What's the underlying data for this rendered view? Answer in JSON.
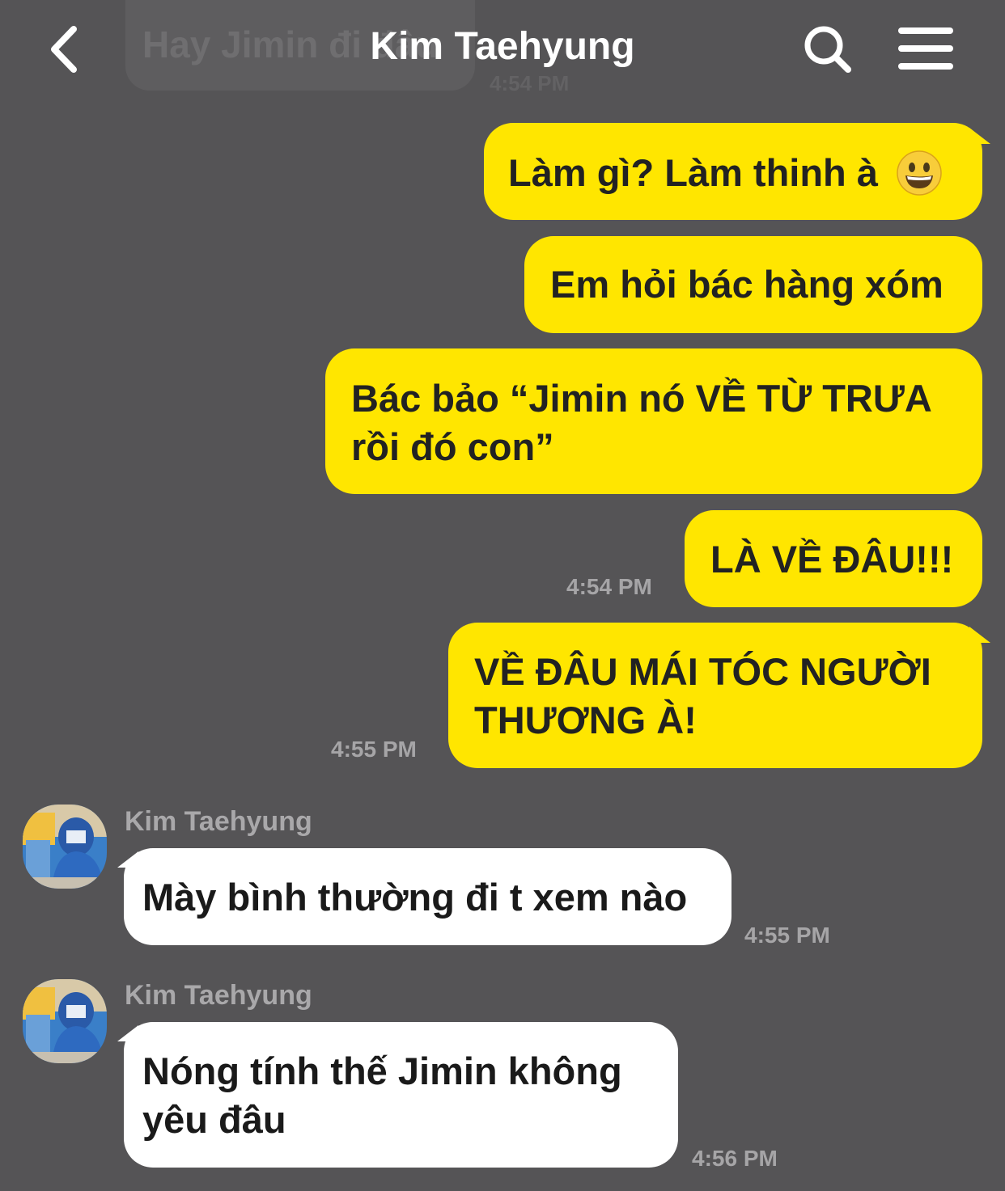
{
  "header": {
    "title": "Kim Taehyung",
    "back_icon": "chevron-left-icon",
    "search_icon": "search-icon",
    "menu_icon": "hamburger-menu-icon",
    "faded_previous_message": "Hay Jimin đi đâu",
    "faded_previous_time": "4:54 PM"
  },
  "colors": {
    "background": "#555456",
    "outgoing_bubble": "#ffe600",
    "incoming_bubble": "#ffffff",
    "timestamp": "#a6a5a7"
  },
  "messages": [
    {
      "direction": "out",
      "text": "Làm gì? Làm thinh à",
      "emoji": "grinning-face-emoji"
    },
    {
      "direction": "out",
      "text": "Em hỏi bác hàng xóm"
    },
    {
      "direction": "out",
      "lines": [
        "Bác bảo “Jimin nó VỀ TỪ TRƯA",
        "rồi đó con”"
      ]
    },
    {
      "direction": "out",
      "text": "LÀ VỀ ĐÂU!!!",
      "time": "4:54 PM"
    },
    {
      "direction": "out",
      "lines": [
        "VỀ ĐÂU MÁI TÓC NGƯỜI",
        "THƯƠNG À!"
      ],
      "time": "4:55 PM"
    },
    {
      "direction": "in",
      "sender": "Kim Taehyung",
      "text": "Mày bình thường đi t xem nào",
      "time": "4:55 PM"
    },
    {
      "direction": "in",
      "sender": "Kim Taehyung",
      "lines": [
        "Nóng tính thế Jimin không",
        "yêu đâu"
      ],
      "time": "4:56 PM"
    }
  ]
}
